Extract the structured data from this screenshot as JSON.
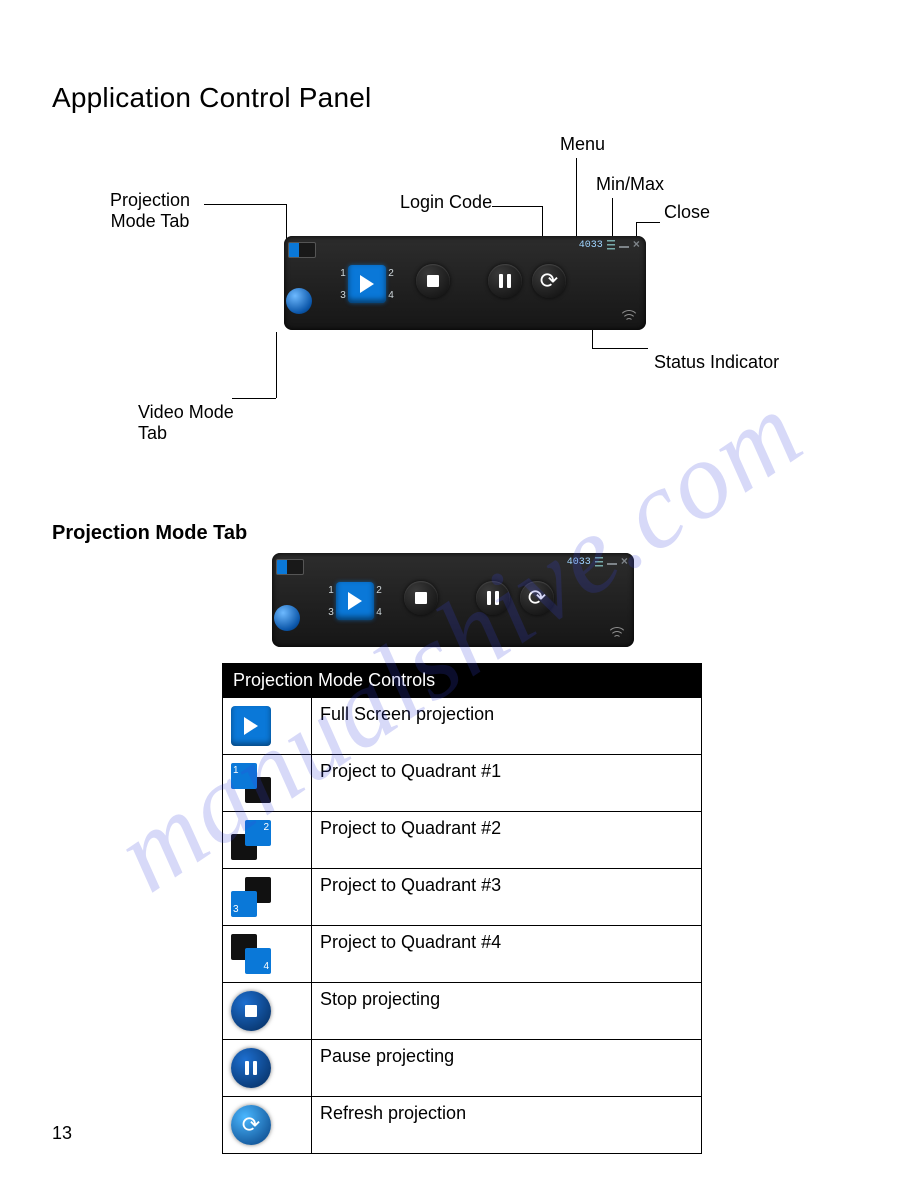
{
  "page": {
    "title": "Application Control Panel",
    "section_heading": "Projection Mode Tab",
    "number": "13",
    "watermark": "manualshive.com"
  },
  "diagram": {
    "labels": {
      "projection_mode_tab": "Projection\nMode Tab",
      "login_code": "Login Code",
      "menu": "Menu",
      "min_max": "Min/Max",
      "close": "Close",
      "video_mode_tab": "Video Mode\nTab",
      "status_indicator": "Status Indicator"
    },
    "login_code_value": "4033"
  },
  "table": {
    "header": "Projection Mode Controls",
    "rows": [
      {
        "desc": "Full Screen projection"
      },
      {
        "desc": "Project to Quadrant #1"
      },
      {
        "desc": "Project to Quadrant #2"
      },
      {
        "desc": "Project to Quadrant #3"
      },
      {
        "desc": "Project to Quadrant #4"
      },
      {
        "desc": "Stop projecting"
      },
      {
        "desc": "Pause projecting"
      },
      {
        "desc": "Refresh projection"
      }
    ],
    "quadrant_numbers": [
      "1",
      "2",
      "3",
      "4"
    ]
  }
}
